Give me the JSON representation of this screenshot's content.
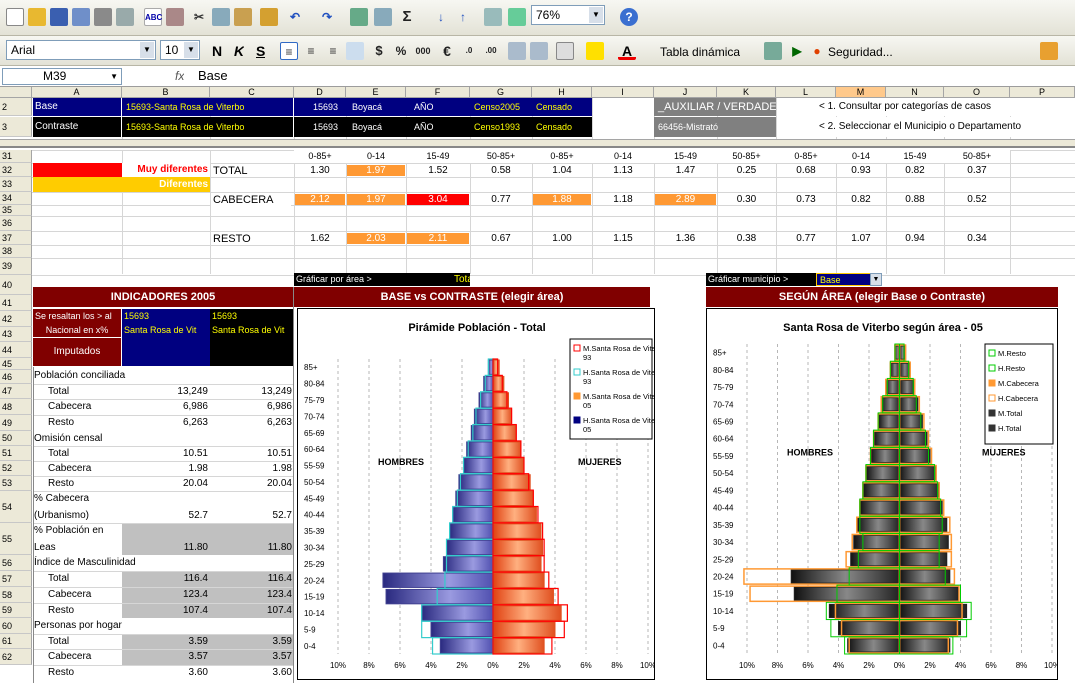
{
  "toolbar": {
    "zoom": "76%",
    "font": "Arial",
    "size": "10",
    "bold": "N",
    "italic": "K",
    "underline": "S",
    "pivot": "Tabla dinámica",
    "security": "Seguridad..."
  },
  "formula": {
    "namebox": "M39",
    "fx": "fx",
    "value": "Base"
  },
  "cols": [
    "A",
    "B",
    "C",
    "D",
    "E",
    "F",
    "G",
    "H",
    "I",
    "J",
    "K",
    "L",
    "M",
    "N",
    "O",
    "P",
    "Q"
  ],
  "rows_top": [
    "2",
    "3"
  ],
  "rows_main": [
    "31",
    "32",
    "33",
    "34",
    "35",
    "36",
    "37",
    "38",
    "39",
    "40",
    "41",
    "42",
    "43",
    "44",
    "45",
    "46",
    "47",
    "48",
    "49",
    "50",
    "51",
    "52",
    "53",
    "54",
    "55",
    "56",
    "57",
    "58",
    "59",
    "60",
    "61",
    "62"
  ],
  "r2": {
    "a": "Base",
    "b": "15693-Santa Rosa de Viterbo",
    "d": "15693",
    "e": "Boyacá",
    "f": "AÑO",
    "g": "Censo2005",
    "h": "Censado",
    "j": "_AUXILIAR / VERDADERO",
    "l": "< 1. Consultar por categorías de casos"
  },
  "r3": {
    "a": "Contraste",
    "b": "15693-Santa Rosa de Viterbo",
    "d": "15693",
    "e": "Boyacá",
    "f": "AÑO",
    "g": "Censo1993",
    "h": "Censado",
    "j": "66456-Mistrató",
    "l": "< 2. Seleccionar el Municipio o Departamento"
  },
  "age_headers": [
    "0-85+",
    "0-14",
    "15-49",
    "50-85+",
    "0-85+",
    "0-14",
    "15-49",
    "50-85+",
    "0-85+",
    "0-14",
    "15-49",
    "50-85+"
  ],
  "legend": {
    "muy": "Muy diferentes",
    "dif": "Diferentes"
  },
  "matrix": [
    {
      "label": "TOTAL",
      "vals": [
        "1.30",
        "1.97",
        "1.52",
        "0.58",
        "1.04",
        "1.13",
        "1.47",
        "0.25",
        "0.68",
        "0.93",
        "0.82",
        "0.37"
      ],
      "hl": [
        "",
        "o",
        "",
        "",
        "",
        "",
        "",
        "",
        "",
        "",
        "",
        ""
      ]
    },
    {
      "label": "CABECERA",
      "vals": [
        "2.12",
        "1.97",
        "3.04",
        "0.77",
        "1.88",
        "1.18",
        "2.89",
        "0.30",
        "0.73",
        "0.82",
        "0.88",
        "0.52"
      ],
      "hl": [
        "o",
        "o",
        "r",
        "",
        "o",
        "",
        "o",
        "",
        "",
        "",
        "",
        ""
      ]
    },
    {
      "label": "RESTO",
      "vals": [
        "1.62",
        "2.03",
        "2.11",
        "0.67",
        "1.00",
        "1.15",
        "1.36",
        "0.38",
        "0.77",
        "1.07",
        "0.94",
        "0.34"
      ],
      "hl": [
        "",
        "o",
        "o",
        "",
        "",
        "",
        "",
        "",
        "",
        "",
        "",
        ""
      ]
    }
  ],
  "graf_area": {
    "label": "Gráficar por área >",
    "value": "Total"
  },
  "graf_mun": {
    "label": "Gráficar municipio >",
    "value": "Base"
  },
  "ind": {
    "title": "INDICADORES 2005",
    "hl1": "Se resaltan los > al",
    "hl2": "Nacional en x%",
    "hl3": "Imputados",
    "b41": "15693",
    "c41": "15693",
    "b42": "Santa Rosa de Vit",
    "c42": "Santa Rosa de Vit"
  },
  "indicators": [
    {
      "label": "Población conciliada",
      "b": "",
      "c": "",
      "sec": true
    },
    {
      "label": "Total",
      "b": "13,249",
      "c": "13,249"
    },
    {
      "label": "Cabecera",
      "b": "6,986",
      "c": "6,986"
    },
    {
      "label": "Resto",
      "b": "6,263",
      "c": "6,263"
    },
    {
      "label": "Omisión censal",
      "b": "",
      "c": "",
      "sec": true
    },
    {
      "label": "Total",
      "b": "10.51",
      "c": "10.51"
    },
    {
      "label": "Cabecera",
      "b": "1.98",
      "c": "1.98"
    },
    {
      "label": "Resto",
      "b": "20.04",
      "c": "20.04"
    },
    {
      "label": "% Cabecera",
      "label2": "(Urbanismo)",
      "b": "52.7",
      "c": "52.7",
      "tall": true
    },
    {
      "label": "% Población en",
      "label2": "Leas",
      "b": "11.80",
      "c": "11.80",
      "tall": true,
      "gray": true
    },
    {
      "label": "Índice de Masculinidad",
      "b": "",
      "c": "",
      "sec": true
    },
    {
      "label": "Total",
      "b": "116.4",
      "c": "116.4",
      "gray": true
    },
    {
      "label": "Cabecera",
      "b": "123.4",
      "c": "123.4",
      "gray": true
    },
    {
      "label": "Resto",
      "b": "107.4",
      "c": "107.4",
      "gray": true
    },
    {
      "label": "Personas por hogar",
      "b": "",
      "c": "",
      "sec": true
    },
    {
      "label": "Total",
      "b": "3.59",
      "c": "3.59",
      "gray": true
    },
    {
      "label": "Cabecera",
      "b": "3.57",
      "c": "3.57",
      "gray": true
    },
    {
      "label": "Resto",
      "b": "3.60",
      "c": "3.60"
    }
  ],
  "chart_data": [
    {
      "type": "bar",
      "header": "BASE vs CONTRASTE (elegir área)",
      "title": "Pirámide Población - Total",
      "categories": [
        "0-4",
        "5-9",
        "10-14",
        "15-19",
        "20-24",
        "25-29",
        "30-34",
        "35-39",
        "40-44",
        "45-49",
        "50-54",
        "55-59",
        "60-64",
        "65-69",
        "70-74",
        "75-79",
        "80-84",
        "85+"
      ],
      "series": [
        {
          "name": "M.Santa Rosa de Viterbo 93",
          "values": [
            3.8,
            4.6,
            4.8,
            4.2,
            3.6,
            3.3,
            3.3,
            3.2,
            2.9,
            2.6,
            2.3,
            2.0,
            1.8,
            1.5,
            1.2,
            0.9,
            0.6,
            0.3
          ]
        },
        {
          "name": "H.Santa Rosa de Viterbo 93",
          "values": [
            -3.9,
            -4.6,
            -4.6,
            -3.6,
            -3.1,
            -3.0,
            -3.0,
            -2.8,
            -2.6,
            -2.3,
            -2.1,
            -1.9,
            -1.6,
            -1.3,
            -1.1,
            -0.8,
            -0.5,
            -0.3
          ]
        },
        {
          "name": "M.Santa Rosa de Viterbo 05",
          "values": [
            3.3,
            4.0,
            4.4,
            3.9,
            3.3,
            3.1,
            3.2,
            3.1,
            2.8,
            2.6,
            2.4,
            2.0,
            1.8,
            1.5,
            1.2,
            1.0,
            0.7,
            0.4
          ]
        },
        {
          "name": "H.Santa Rosa de Viterbo 05",
          "values": [
            -3.4,
            -4.0,
            -4.6,
            -6.9,
            -7.1,
            -3.2,
            -3.0,
            -2.8,
            -2.6,
            -2.4,
            -2.2,
            -1.9,
            -1.7,
            -1.4,
            -1.2,
            -0.9,
            -0.6,
            -0.3
          ]
        }
      ],
      "xticks": [
        "10%",
        "8%",
        "6%",
        "4%",
        "2%",
        "0%",
        "2%",
        "4%",
        "6%",
        "8%",
        "10%"
      ],
      "left_label": "HOMBRES",
      "right_label": "MUJERES"
    },
    {
      "type": "bar",
      "header": "SEGÚN ÁREA (elegir Base o Contraste)",
      "title": "Santa Rosa de Viterbo según área - 05",
      "categories": [
        "0-4",
        "5-9",
        "10-14",
        "15-19",
        "20-24",
        "25-29",
        "30-34",
        "35-39",
        "40-44",
        "45-49",
        "50-54",
        "55-59",
        "60-64",
        "65-69",
        "70-74",
        "75-79",
        "80-84",
        "85+"
      ],
      "series": [
        {
          "name": "M.Resto",
          "values": [
            3.5,
            4.4,
            4.7,
            4.0,
            3.0,
            2.6,
            2.6,
            2.8,
            2.7,
            2.5,
            2.3,
            1.9,
            1.7,
            1.4,
            1.1,
            0.9,
            0.6,
            0.3
          ]
        },
        {
          "name": "H.Resto",
          "values": [
            -3.6,
            -4.5,
            -4.8,
            -4.1,
            -3.3,
            -2.7,
            -2.4,
            -2.6,
            -2.6,
            -2.4,
            -2.2,
            -1.9,
            -1.7,
            -1.4,
            -1.1,
            -0.8,
            -0.6,
            -0.3
          ]
        },
        {
          "name": "M.Cabecera",
          "values": [
            3.2,
            3.8,
            4.1,
            3.9,
            3.6,
            3.4,
            3.4,
            3.3,
            2.9,
            2.6,
            2.4,
            2.1,
            1.9,
            1.6,
            1.3,
            1.0,
            0.7,
            0.4
          ]
        },
        {
          "name": "H.Cabecera",
          "values": [
            -3.3,
            -3.8,
            -4.2,
            -9.8,
            -10.2,
            -3.5,
            -3.1,
            -2.8,
            -2.6,
            -2.4,
            -2.2,
            -1.9,
            -1.7,
            -1.4,
            -1.2,
            -0.9,
            -0.6,
            -0.3
          ]
        },
        {
          "name": "M.Total",
          "values": [
            3.3,
            4.0,
            4.4,
            3.9,
            3.3,
            3.1,
            3.2,
            3.1,
            2.8,
            2.6,
            2.4,
            2.0,
            1.8,
            1.5,
            1.2,
            1.0,
            0.7,
            0.4
          ]
        },
        {
          "name": "H.Total",
          "values": [
            -3.4,
            -4.0,
            -4.6,
            -6.9,
            -7.1,
            -3.2,
            -3.0,
            -2.8,
            -2.6,
            -2.4,
            -2.2,
            -1.9,
            -1.7,
            -1.4,
            -1.2,
            -0.9,
            -0.6,
            -0.3
          ]
        }
      ],
      "xticks": [
        "10%",
        "8%",
        "6%",
        "4%",
        "2%",
        "0%",
        "2%",
        "4%",
        "6%",
        "8%",
        "10%"
      ],
      "left_label": "HOMBRES",
      "right_label": "MUJERES"
    }
  ],
  "colors": {
    "maroon": "#800000",
    "navy": "#000080",
    "orange": "#ff9933",
    "red": "#ff0000",
    "gold": "#ffcc00",
    "gray": "#c0c0c0",
    "excelhdr": "#ece9d8"
  }
}
